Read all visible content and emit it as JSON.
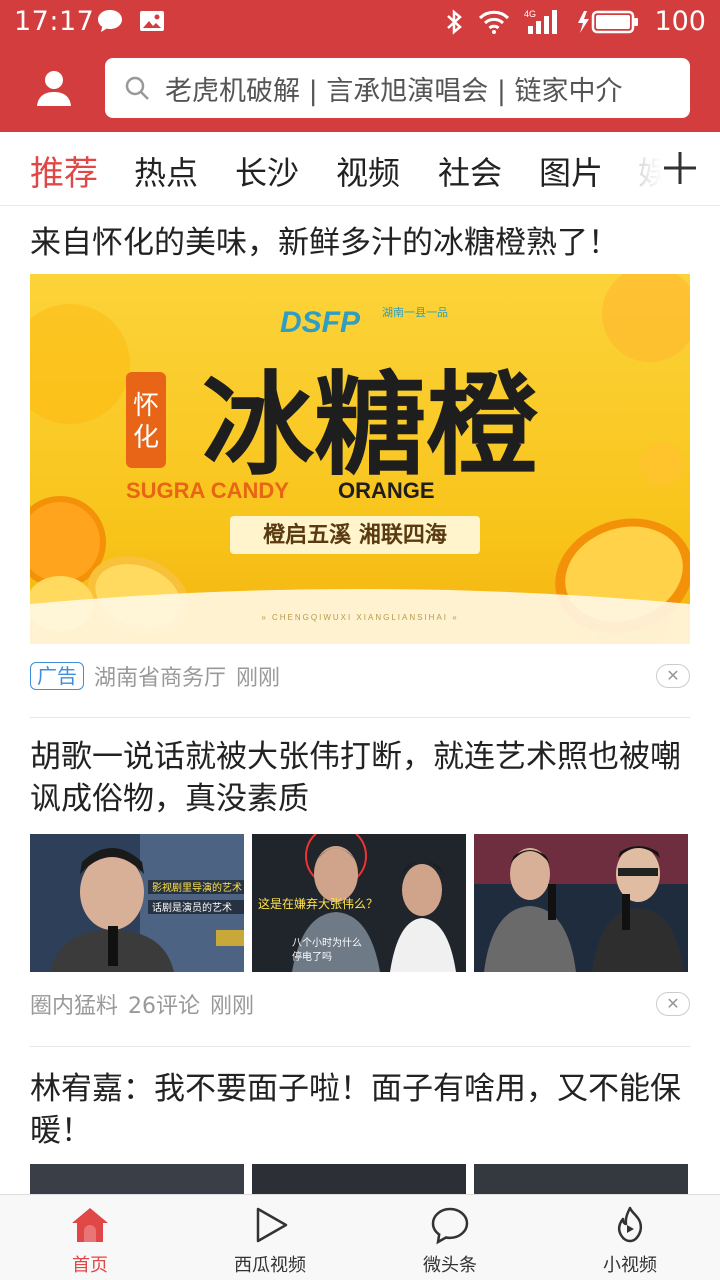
{
  "status_bar": {
    "time": "17:17",
    "network": "4G",
    "battery": "100"
  },
  "header": {
    "search_placeholder": "老虎机破解 | 言承旭演唱会 | 链家中介"
  },
  "tabs": [
    {
      "label": "推荐",
      "active": true
    },
    {
      "label": "热点",
      "active": false
    },
    {
      "label": "长沙",
      "active": false
    },
    {
      "label": "视频",
      "active": false
    },
    {
      "label": "社会",
      "active": false
    },
    {
      "label": "图片",
      "active": false
    },
    {
      "label": "娱",
      "active": false
    }
  ],
  "feed": [
    {
      "title": "来自怀化的美味，新鲜多汁的冰糖橙熟了！",
      "image": {
        "logo": "DSFP",
        "logo_sub": "湖南一县一品",
        "badge": "怀化",
        "headline": "冰糖橙",
        "english": "SUGRA CANDY",
        "english2": "ORANGE",
        "slogan": "橙启五溪  湘联四海",
        "pinyin": "» CHENGQIWUXI XIANGLIANSIHAI «"
      },
      "ad_label": "广告",
      "source": "湖南省商务厅",
      "time": "刚刚"
    },
    {
      "title": "胡歌一说话就被大张伟打断，就连艺术照也被嘲讽成俗物，真没素质",
      "captions": [
        "影视剧里导演的艺术",
        "这是在嫌弃大张伟么？",
        "八个小时为什么停电了吗"
      ],
      "source": "圈内猛料",
      "comments": "26评论",
      "time": "刚刚"
    },
    {
      "title": "林宥嘉：我不要面子啦！面子有啥用，又不能保暖！"
    }
  ],
  "bottom_nav": [
    {
      "label": "首页",
      "icon": "home-icon",
      "active": true
    },
    {
      "label": "西瓜视频",
      "icon": "play-icon",
      "active": false
    },
    {
      "label": "微头条",
      "icon": "chat-bubble-icon",
      "active": false
    },
    {
      "label": "小视频",
      "icon": "flame-play-icon",
      "active": false
    }
  ],
  "colors": {
    "brand_red": "#d43d3d",
    "active_red": "#e04848",
    "ad_blue": "#3d8edb"
  }
}
